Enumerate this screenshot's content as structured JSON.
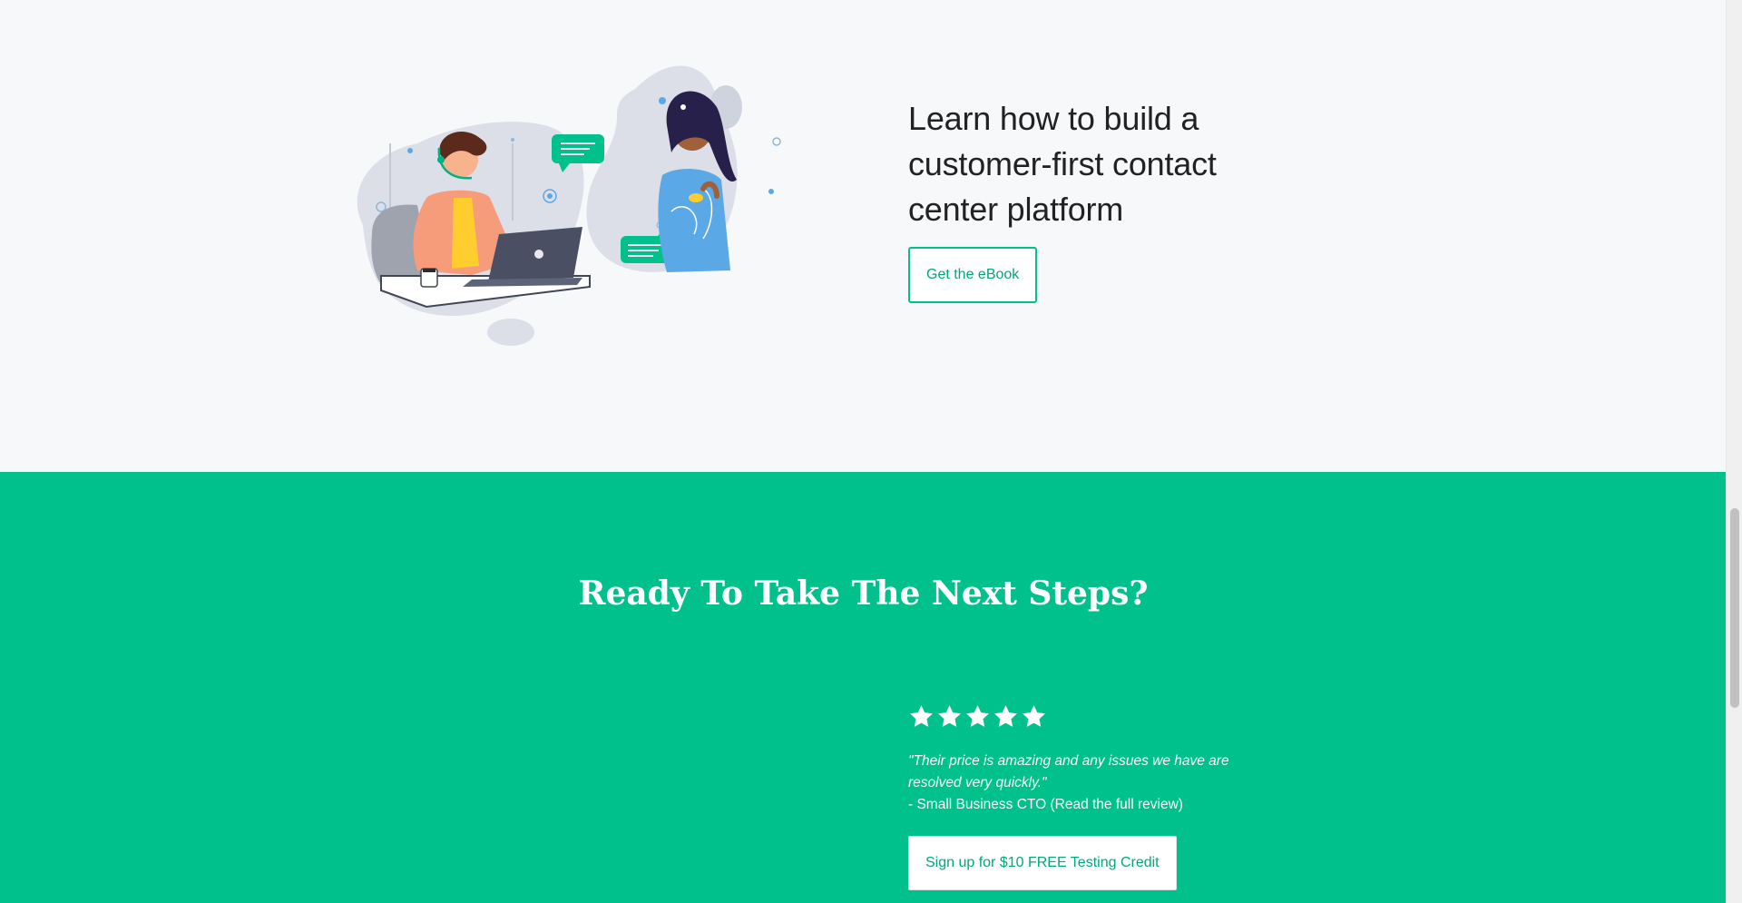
{
  "promo": {
    "heading_line1": "Learn how to build a",
    "heading_line2": "customer-first contact",
    "heading_line3": "center platform",
    "button_label": "Get the eBook"
  },
  "cta": {
    "title": "Ready To Take The Next Steps?",
    "rating": 5,
    "rating_max": 5,
    "quote_line1": "\"Their price is amazing and any issues we have are",
    "quote_line2": "resolved very quickly.\"",
    "attribution": "- Small Business CTO (Read the full review)",
    "button_label": "Sign up for $10 FREE Testing Credit"
  },
  "colors": {
    "brand_green": "#00c08b",
    "page_background": "#f7f8fa",
    "heading_text": "#222222"
  },
  "icons": {
    "rating_star": "star-icon"
  }
}
